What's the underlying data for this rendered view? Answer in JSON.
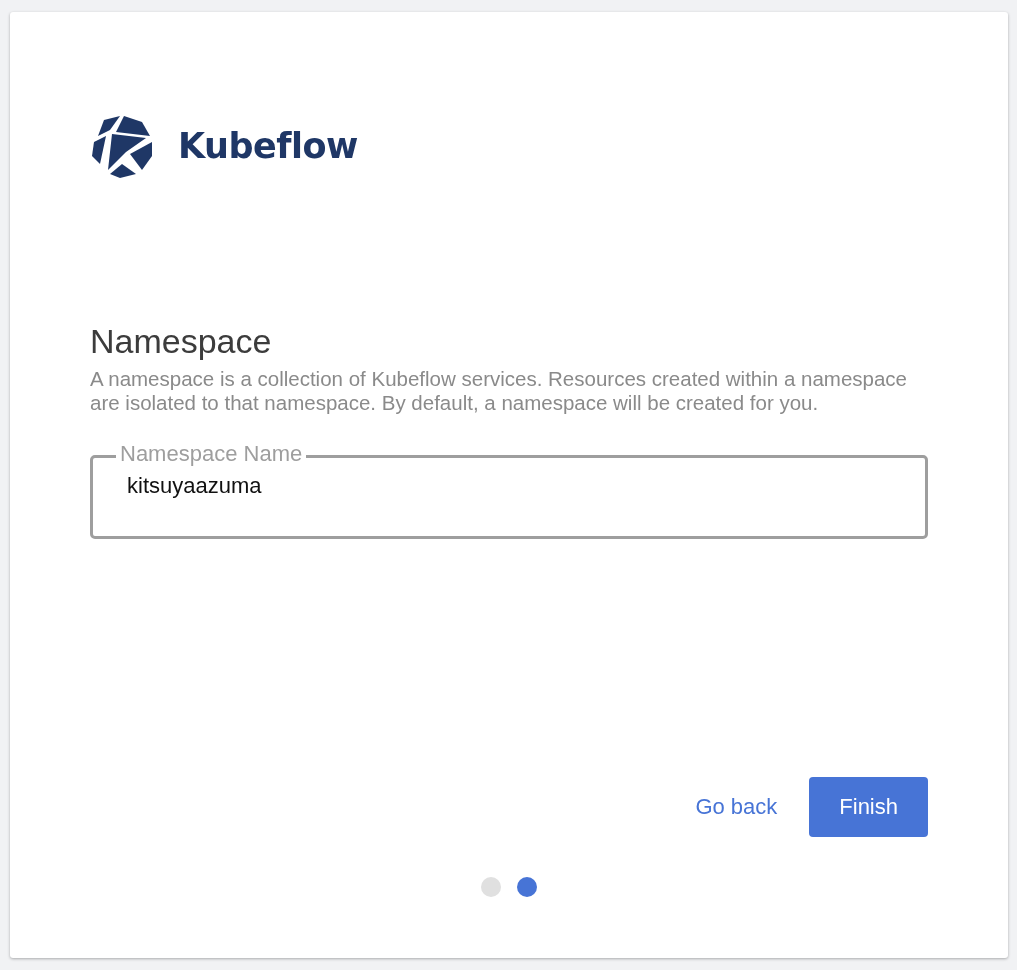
{
  "logo": {
    "text": "Kubeflow"
  },
  "heading": "Namespace",
  "description": "A namespace is a collection of Kubeflow services. Resources created within a namespace are isolated to that namespace. By default, a namespace will be created for you.",
  "field": {
    "label": "Namespace Name",
    "value": "kitsuyaazuma"
  },
  "buttons": [
    {
      "label": "Go back",
      "kind": "text"
    },
    {
      "label": "Finish",
      "kind": "filled"
    }
  ],
  "steps": [
    {
      "selected": false
    },
    {
      "selected": true
    }
  ]
}
